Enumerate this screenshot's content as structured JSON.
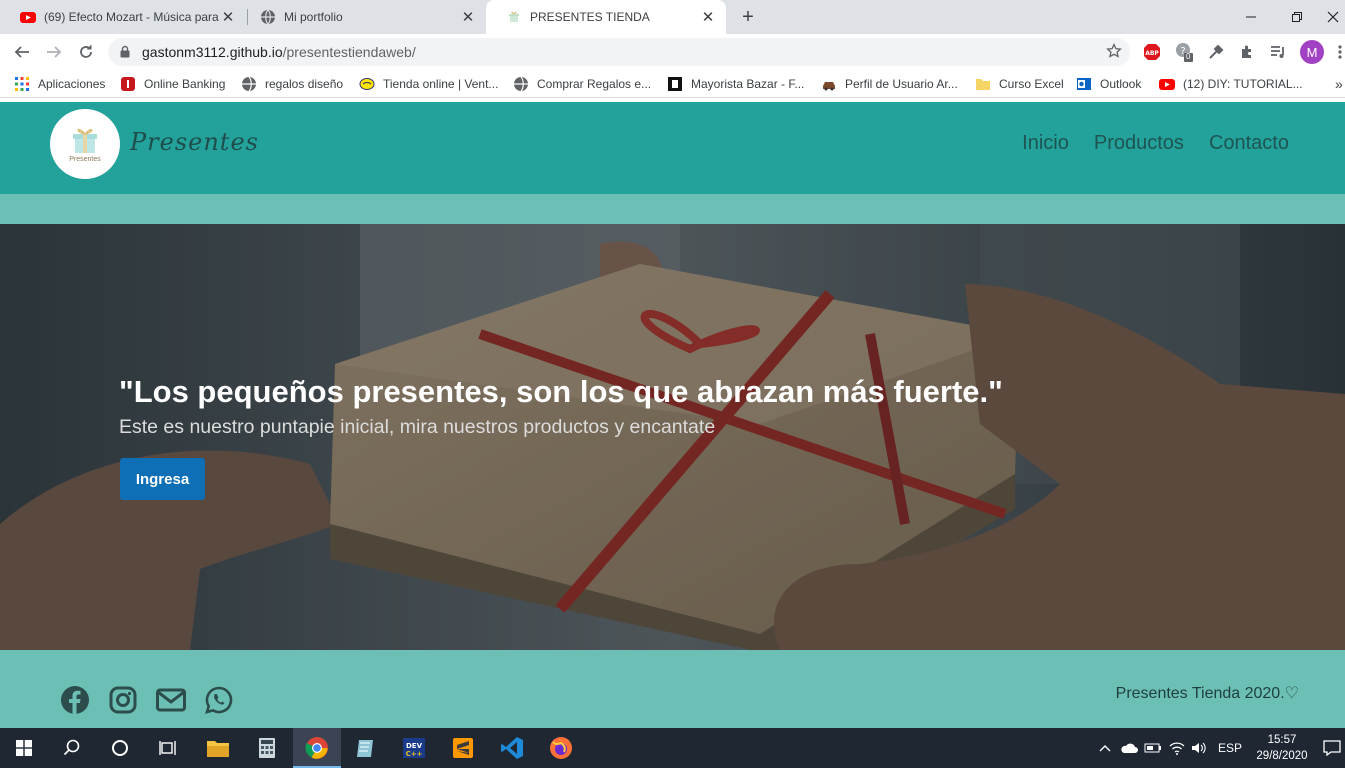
{
  "browser": {
    "tabs": [
      {
        "title": "(69) Efecto Mozart - Música para"
      },
      {
        "title": "Mi portfolio"
      },
      {
        "title": "PRESENTES TIENDA"
      }
    ],
    "url_host": "gastonm3112.github.io",
    "url_path": "/presentestiendaweb/",
    "profile_initial": "M",
    "ext_badge": "0",
    "bookmarks": [
      "Aplicaciones",
      "Online Banking",
      "regalos diseño",
      "Tienda online | Vent...",
      "Comprar Regalos e...",
      "Mayorista Bazar - F...",
      "Perfil de Usuario Ar...",
      "Curso Excel",
      "Outlook",
      "(12) DIY: TUTORIAL..."
    ],
    "overflow": "»"
  },
  "site": {
    "logo_text": "Presentes",
    "brand": "Presentes",
    "nav": [
      "Inicio",
      "Productos",
      "Contacto"
    ],
    "hero_title": "\"Los pequeños presentes, son los que abrazan más fuerte.\"",
    "hero_subtitle": "Este es nuestro puntapie inicial, mira nuestros productos y encantate",
    "cta_label": "Ingresa",
    "footer_copy": "Presentes Tienda 2020.♡",
    "social": [
      "facebook-icon",
      "instagram-icon",
      "mail-icon",
      "whatsapp-icon"
    ]
  },
  "taskbar": {
    "lang": "ESP",
    "time": "15:57",
    "date": "29/8/2020"
  },
  "colors": {
    "header": "#23a19b",
    "stripe": "#6cbfb5",
    "cta": "#0f6fb6"
  }
}
